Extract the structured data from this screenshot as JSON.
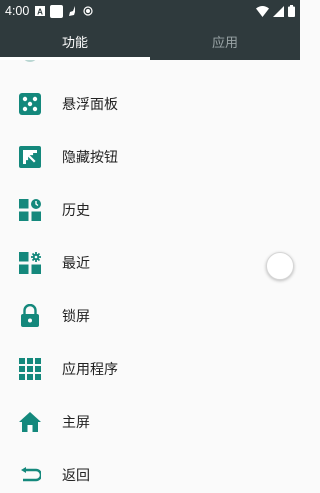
{
  "status_bar": {
    "time": "4:00",
    "left_icons": [
      "font-a-icon",
      "blank-square-icon",
      "broom-icon",
      "record-dot-icon"
    ],
    "right_icons": [
      "wifi-icon",
      "cellular-signal-icon",
      "battery-icon"
    ]
  },
  "tabs": [
    {
      "label": "功能",
      "active": true
    },
    {
      "label": "应用",
      "active": false
    }
  ],
  "menu": [
    {
      "label": "悬浮面板",
      "icon": "dice-panel-icon"
    },
    {
      "label": "隐藏按钮",
      "icon": "hide-arrow-icon"
    },
    {
      "label": "历史",
      "icon": "history-grid-icon"
    },
    {
      "label": "最近",
      "icon": "recent-grid-icon"
    },
    {
      "label": "锁屏",
      "icon": "lock-icon"
    },
    {
      "label": "应用程序",
      "icon": "apps-grid-icon"
    },
    {
      "label": "主屏",
      "icon": "home-icon"
    },
    {
      "label": "返回",
      "icon": "back-arrow-icon"
    }
  ],
  "colors": {
    "header": "#2f3a3d",
    "icon_teal": "#14887c",
    "background": "#fafafa"
  }
}
